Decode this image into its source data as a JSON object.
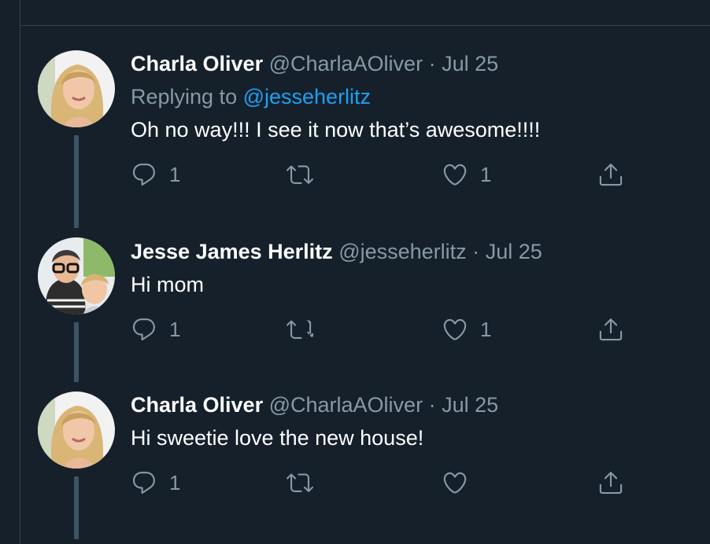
{
  "tweets": [
    {
      "name": "Charla Oliver",
      "handle": "@CharlaAOliver",
      "dot": "·",
      "date": "Jul 25",
      "replying_prefix": "Replying to ",
      "replying_to": "@jesseherlitz",
      "text": "Oh no way!!! I see it now that’s awesome!!!!",
      "reply_count": "1",
      "retweet_count": "",
      "like_count": "1"
    },
    {
      "name": "Jesse James Herlitz",
      "handle": "@jesseherlitz",
      "dot": "·",
      "date": "Jul 25",
      "text": "Hi mom",
      "reply_count": "1",
      "retweet_count": "",
      "like_count": "1"
    },
    {
      "name": "Charla Oliver",
      "handle": "@CharlaAOliver",
      "dot": "·",
      "date": "Jul 25",
      "text": "Hi sweetie love the new house!",
      "reply_count": "1",
      "retweet_count": "",
      "like_count": ""
    }
  ],
  "colors": {
    "background": "#15202b",
    "divider": "#38444d",
    "muted": "#8899a6",
    "link": "#1da1f2",
    "thread_line": "#3d5466"
  },
  "icons": {
    "reply": "reply-icon",
    "retweet": "retweet-icon",
    "like": "heart-icon",
    "share": "share-icon"
  }
}
